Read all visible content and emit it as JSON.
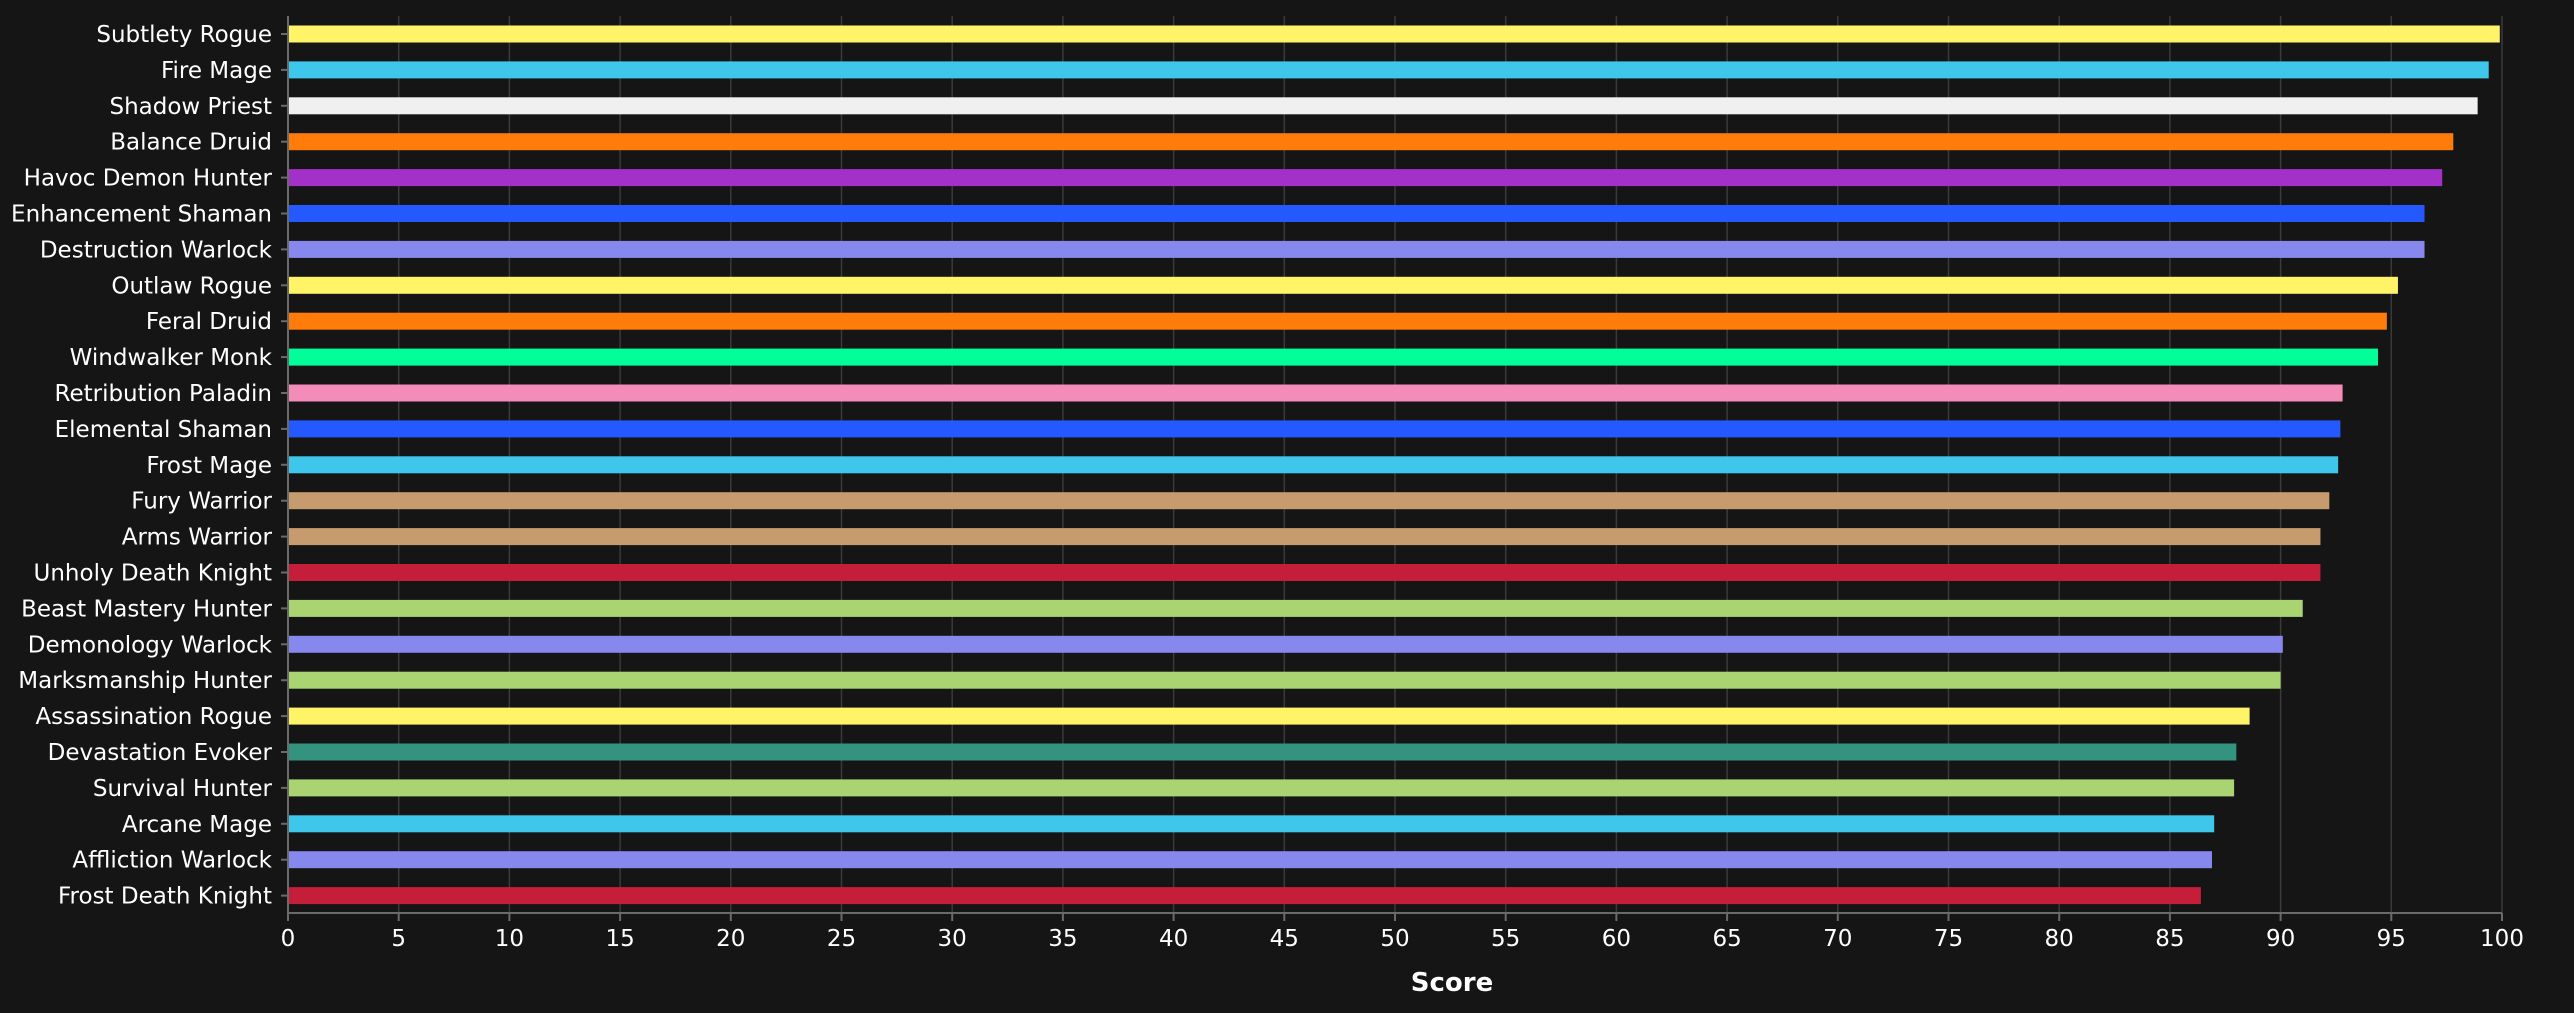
{
  "chart_data": {
    "type": "bar",
    "orientation": "horizontal",
    "title": "",
    "xlabel": "Score",
    "ylabel": "",
    "xlim": [
      0,
      100
    ],
    "xticks": [
      0,
      5,
      10,
      15,
      20,
      25,
      30,
      35,
      40,
      45,
      50,
      55,
      60,
      65,
      70,
      75,
      80,
      85,
      90,
      95,
      100
    ],
    "grid": true,
    "legend": "none",
    "background": "#151515",
    "categories": [
      "Subtlety Rogue",
      "Fire Mage",
      "Shadow Priest",
      "Balance Druid",
      "Havoc Demon Hunter",
      "Enhancement Shaman",
      "Destruction Warlock",
      "Outlaw Rogue",
      "Feral Druid",
      "Windwalker Monk",
      "Retribution Paladin",
      "Elemental Shaman",
      "Frost Mage",
      "Fury Warrior",
      "Arms Warrior",
      "Unholy Death Knight",
      "Beast Mastery Hunter",
      "Demonology Warlock",
      "Marksmanship Hunter",
      "Assassination Rogue",
      "Devastation Evoker",
      "Survival Hunter",
      "Arcane Mage",
      "Affliction Warlock",
      "Frost Death Knight"
    ],
    "values": [
      99.9,
      99.4,
      98.9,
      97.8,
      97.3,
      96.5,
      96.5,
      95.3,
      94.8,
      94.4,
      92.8,
      92.7,
      92.6,
      92.2,
      91.8,
      91.8,
      91.0,
      90.1,
      90.0,
      88.6,
      88.0,
      87.9,
      87.0,
      86.9,
      86.4
    ],
    "colors": [
      "#FFF468",
      "#3FC7EB",
      "#F0F0F0",
      "#FF7C0A",
      "#A330C9",
      "#2459FF",
      "#8788EE",
      "#FFF468",
      "#FF7C0A",
      "#00FF98",
      "#F48CBA",
      "#2459FF",
      "#3FC7EB",
      "#C69B6D",
      "#C69B6D",
      "#C41E3A",
      "#AAD372",
      "#8788EE",
      "#AAD372",
      "#FFF468",
      "#33937F",
      "#AAD372",
      "#3FC7EB",
      "#8788EE",
      "#C41E3A"
    ]
  }
}
